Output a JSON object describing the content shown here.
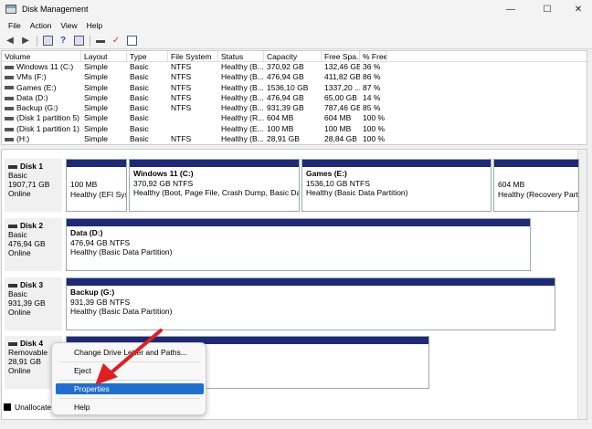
{
  "window": {
    "title": "Disk Management",
    "minimize_icon": "—",
    "maximize_icon": "☐",
    "close_icon": "✕"
  },
  "menu": [
    "File",
    "Action",
    "View",
    "Help"
  ],
  "toolbar": {
    "icons": [
      "back-arrow-icon",
      "forward-arrow-icon",
      "list-view-icon",
      "help-icon",
      "graphical-view-icon",
      "disk-icon",
      "check-icon",
      "properties-icon"
    ]
  },
  "volume_table": {
    "columns": [
      "Volume",
      "Layout",
      "Type",
      "File System",
      "Status",
      "Capacity",
      "Free Spa...",
      "% Free"
    ],
    "rows": [
      [
        "Windows 11 (C:)",
        "Simple",
        "Basic",
        "NTFS",
        "Healthy (B...",
        "370,92 GB",
        "132,46 GB",
        "36 %"
      ],
      [
        "VMs (F:)",
        "Simple",
        "Basic",
        "NTFS",
        "Healthy (B...",
        "476,94 GB",
        "411,82 GB",
        "86 %"
      ],
      [
        "Games (E:)",
        "Simple",
        "Basic",
        "NTFS",
        "Healthy (B...",
        "1536,10 GB",
        "1337,20 ...",
        "87 %"
      ],
      [
        "Data (D:)",
        "Simple",
        "Basic",
        "NTFS",
        "Healthy (B...",
        "476,94 GB",
        "65,00 GB",
        "14 %"
      ],
      [
        "Backup (G:)",
        "Simple",
        "Basic",
        "NTFS",
        "Healthy (B...",
        "931,39 GB",
        "787,46 GB",
        "85 %"
      ],
      [
        "(Disk 1 partition 5)",
        "Simple",
        "Basic",
        "",
        "Healthy (R...",
        "604 MB",
        "604 MB",
        "100 %"
      ],
      [
        "(Disk 1 partition 1)",
        "Simple",
        "Basic",
        "",
        "Healthy (E...",
        "100 MB",
        "100 MB",
        "100 %"
      ],
      [
        "(H:)",
        "Simple",
        "Basic",
        "NTFS",
        "Healthy (B...",
        "28,91 GB",
        "28,84 GB",
        "100 %"
      ]
    ]
  },
  "disks": [
    {
      "name": "Disk 1",
      "type": "Basic",
      "size": "1907,71 GB",
      "status": "Online",
      "partitions": [
        {
          "title": "",
          "line1": "100 MB",
          "line2": "Healthy (EFI Syst"
        },
        {
          "title": "Windows 11  (C:)",
          "line1": "370,92 GB NTFS",
          "line2": "Healthy (Boot, Page File, Crash Dump, Basic Data Pa"
        },
        {
          "title": "Games  (E:)",
          "line1": "1536,10 GB NTFS",
          "line2": "Healthy (Basic Data Partition)"
        },
        {
          "title": "",
          "line1": "604 MB",
          "line2": "Healthy (Recovery Partiti"
        }
      ]
    },
    {
      "name": "Disk 2",
      "type": "Basic",
      "size": "476,94 GB",
      "status": "Online",
      "partitions": [
        {
          "title": "Data  (D:)",
          "line1": "476,94 GB NTFS",
          "line2": "Healthy (Basic Data Partition)"
        }
      ]
    },
    {
      "name": "Disk 3",
      "type": "Basic",
      "size": "931,39 GB",
      "status": "Online",
      "partitions": [
        {
          "title": "Backup  (G:)",
          "line1": "931,39 GB NTFS",
          "line2": "Healthy (Basic Data Partition)"
        }
      ]
    },
    {
      "name": "Disk 4",
      "type": "Removable",
      "size": "28,91 GB",
      "status": "Online"
    }
  ],
  "legend": {
    "label": "Unallocated"
  },
  "context_menu": {
    "items": [
      "Change Drive Letter and Paths...",
      "Eject",
      "Properties",
      "Help"
    ],
    "selected": "Properties"
  },
  "colors": {
    "partition_stripe": "#1d2a78",
    "selection": "#1f6fd1",
    "annotation_arrow": "#e02020"
  }
}
